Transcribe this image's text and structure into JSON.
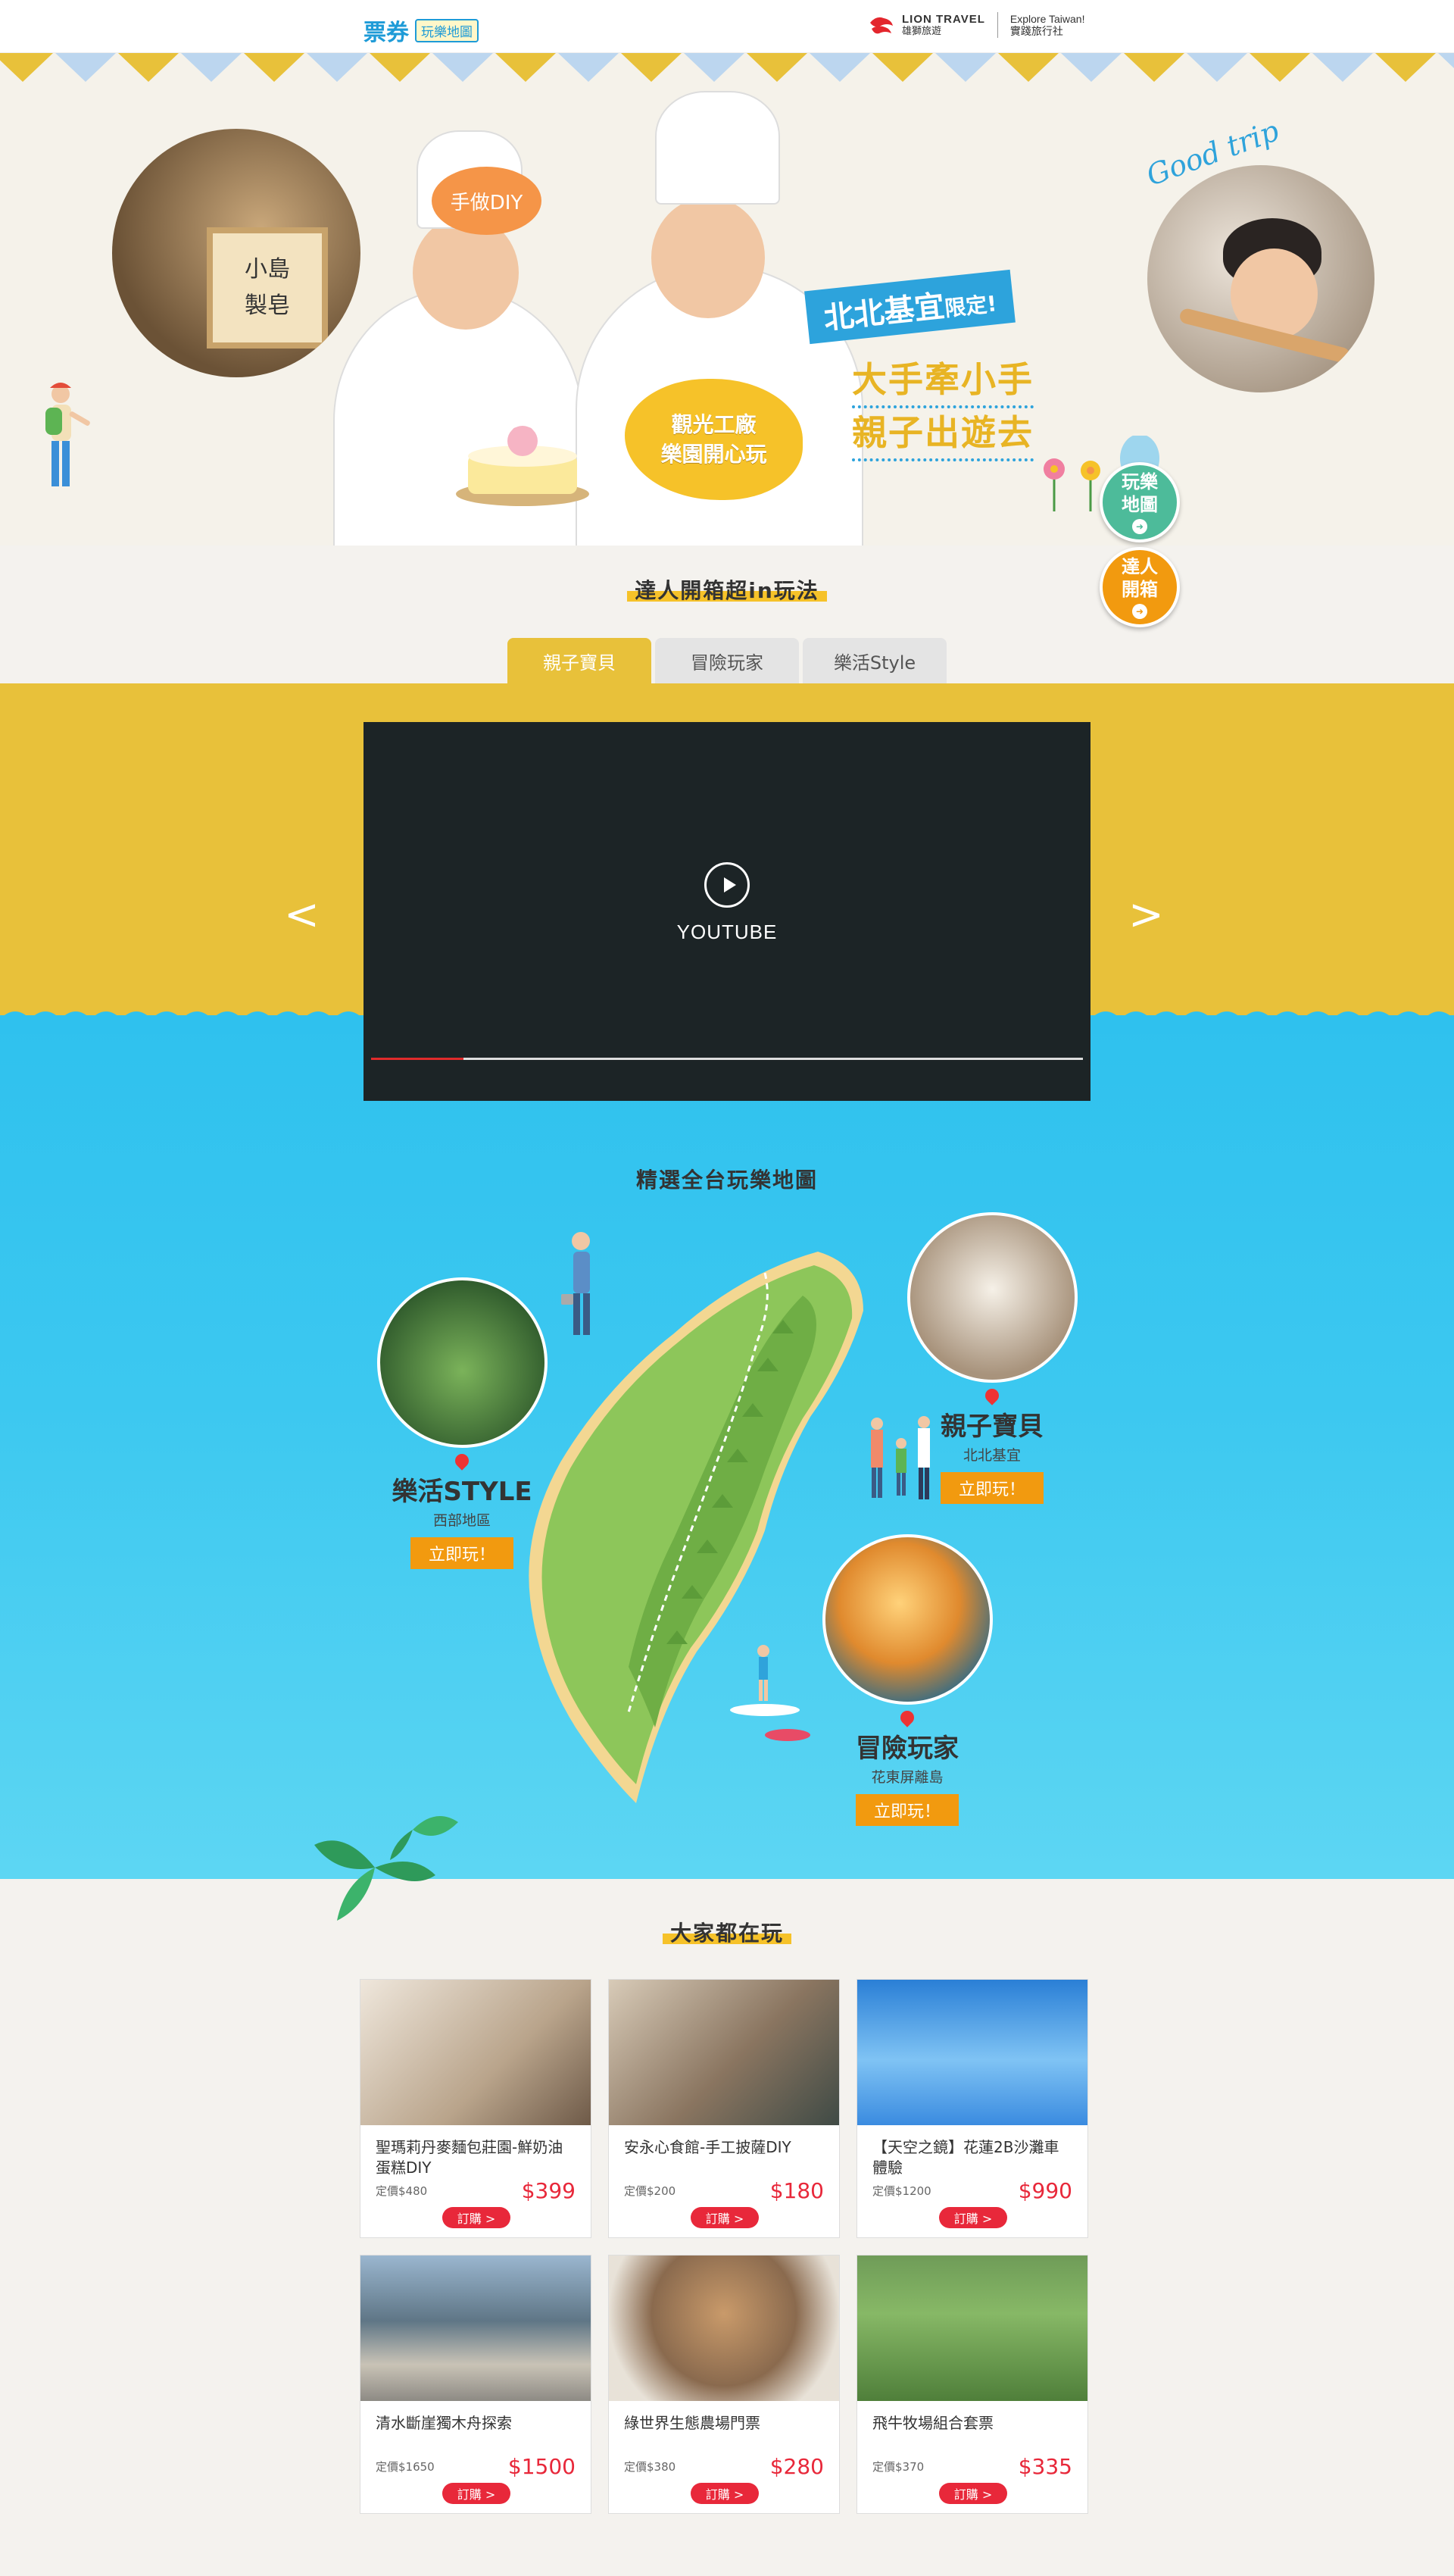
{
  "header": {
    "brand": "票券",
    "brand_tag": "玩樂地圖",
    "partner_en": "LION TRAVEL",
    "partner_zh": "雄獅旅遊",
    "explore_en": "Explore Taiwan!",
    "explore_zh": "實踐旅行社"
  },
  "hero": {
    "soap_sign_line1": "小島",
    "soap_sign_line2": "製皂",
    "bubble_diy": "手做DIY",
    "bubble_factory_line1": "觀光工廠",
    "bubble_factory_line2": "樂園開心玩",
    "badge_main": "北北基宜",
    "badge_small": "限定!",
    "line1": "大手牽小手",
    "line2": "親子出遊去",
    "script_text": "Good trip"
  },
  "float_buttons": [
    {
      "line1": "玩樂",
      "line2": "地圖",
      "color": "#4dbb9a"
    },
    {
      "line1": "達人",
      "line2": "開箱",
      "color": "#f29a0f"
    }
  ],
  "expert_section": {
    "title": "達人開箱超in玩法",
    "tabs": [
      "親子寶貝",
      "冒險玩家",
      "樂活Style"
    ],
    "active_tab": 0
  },
  "video": {
    "label": "YOUTUBE",
    "progress": 0.13,
    "prev": "<",
    "next": ">"
  },
  "map_section": {
    "title": "精選全台玩樂地圖",
    "spots": [
      {
        "name": "親子寶貝",
        "region": "北北基宜",
        "button": "立即玩！"
      },
      {
        "name": "樂活STYLE",
        "region": "西部地區",
        "button": "立即玩！"
      },
      {
        "name": "冒險玩家",
        "region": "花東屏離島",
        "button": "立即玩！"
      }
    ]
  },
  "popular": {
    "title": "大家都在玩",
    "cards": [
      {
        "title": "聖瑪莉丹麥麵包莊園-鮮奶油蛋糕DIY",
        "original": "定價$480",
        "price": "$399",
        "button": "訂購 >"
      },
      {
        "title": "安永心食館-手工披薩DIY",
        "original": "定價$200",
        "price": "$180",
        "button": "訂購 >"
      },
      {
        "title": "【天空之鏡】花蓮2B沙灘車體驗",
        "original": "定價$1200",
        "price": "$990",
        "button": "訂購 >"
      },
      {
        "title": "清水斷崖獨木舟探索",
        "original": "定價$1650",
        "price": "$1500",
        "button": "訂購 >"
      },
      {
        "title": "綠世界生態農場門票",
        "original": "定價$380",
        "price": "$280",
        "button": "訂購 >"
      },
      {
        "title": "飛牛牧場組合套票",
        "original": "定價$370",
        "price": "$335",
        "button": "訂購 >"
      }
    ]
  },
  "colors": {
    "yellow": "#e8c13a",
    "water": "#2fc1ee",
    "price_red": "#e8283a",
    "orange": "#f29a0f",
    "teal": "#4dbb9a",
    "blue": "#1e9bd7"
  }
}
